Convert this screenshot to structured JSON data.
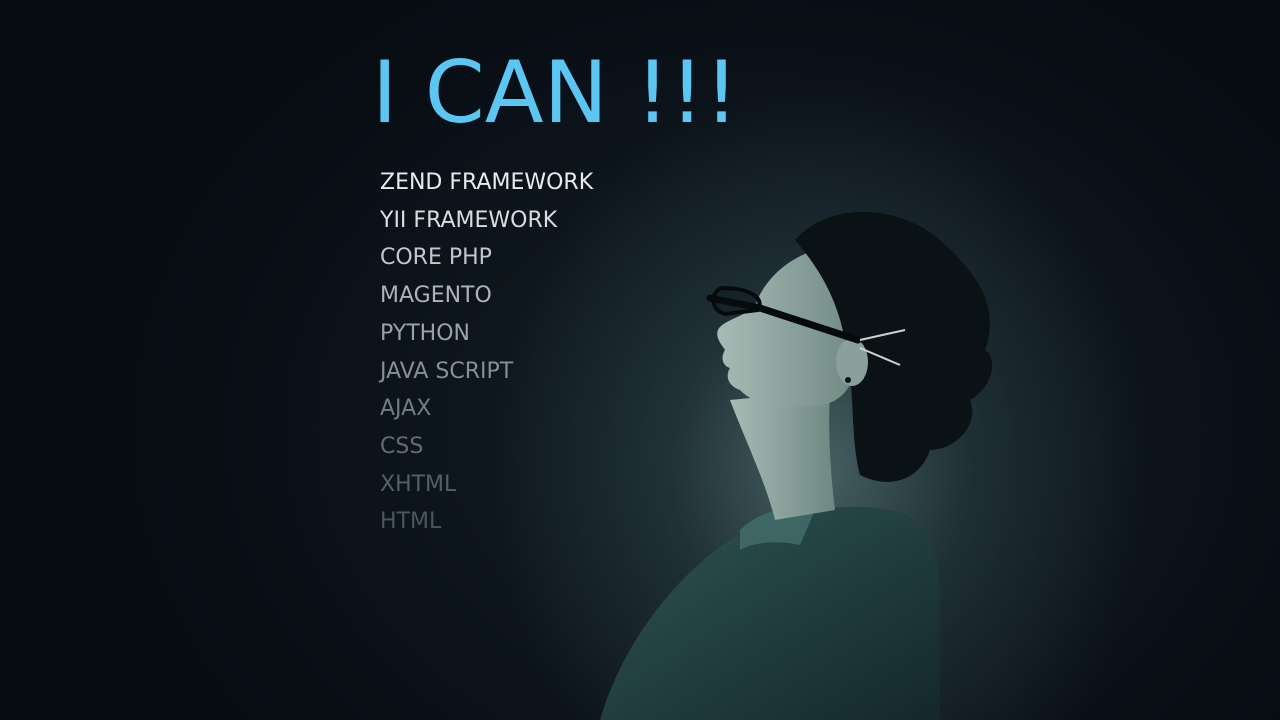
{
  "headline": "I CAN !!!",
  "skills": [
    {
      "label": "ZEND FRAMEWORK",
      "color": "#e8eaed"
    },
    {
      "label": "YII FRAMEWORK",
      "color": "#d9dce0"
    },
    {
      "label": "CORE PHP",
      "color": "#c3c7cc"
    },
    {
      "label": "MAGENTO",
      "color": "#aeb3b9"
    },
    {
      "label": "PYTHON",
      "color": "#9ba1a8"
    },
    {
      "label": "JAVA SCRIPT",
      "color": "#878e96"
    },
    {
      "label": "AJAX",
      "color": "#737b84"
    },
    {
      "label": "CSS",
      "color": "#636b74"
    },
    {
      "label": "XHTML",
      "color": "#565e67"
    },
    {
      "label": "HTML",
      "color": "#4d555e"
    }
  ],
  "colors": {
    "headline": "#5cc6f2",
    "background": "#070b12",
    "spotlight": "#5c7d7d"
  }
}
